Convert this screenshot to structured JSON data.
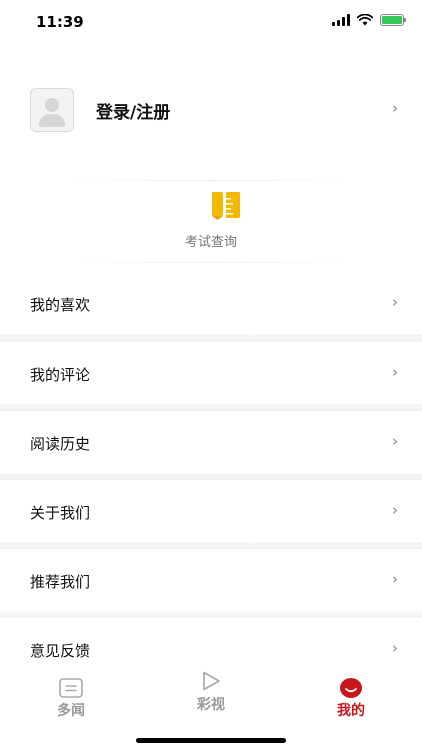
{
  "status": {
    "time": "11:39"
  },
  "profile": {
    "login_label": "登录/注册"
  },
  "exam": {
    "label": "考试查询"
  },
  "menu": [
    {
      "label": "我的喜欢"
    },
    {
      "label": "我的评论"
    },
    {
      "label": "阅读历史"
    },
    {
      "label": "关于我们"
    },
    {
      "label": "推荐我们"
    },
    {
      "label": "意见反馈"
    }
  ],
  "tabs": [
    {
      "label": "多闻",
      "icon": "news-icon",
      "active": false
    },
    {
      "label": "彩视",
      "icon": "play-icon",
      "active": false
    },
    {
      "label": "我的",
      "icon": "smile-icon",
      "active": true
    }
  ],
  "colors": {
    "accent": "#c8161d",
    "exam_icon": "#f5b800",
    "inactive": "#999999"
  }
}
